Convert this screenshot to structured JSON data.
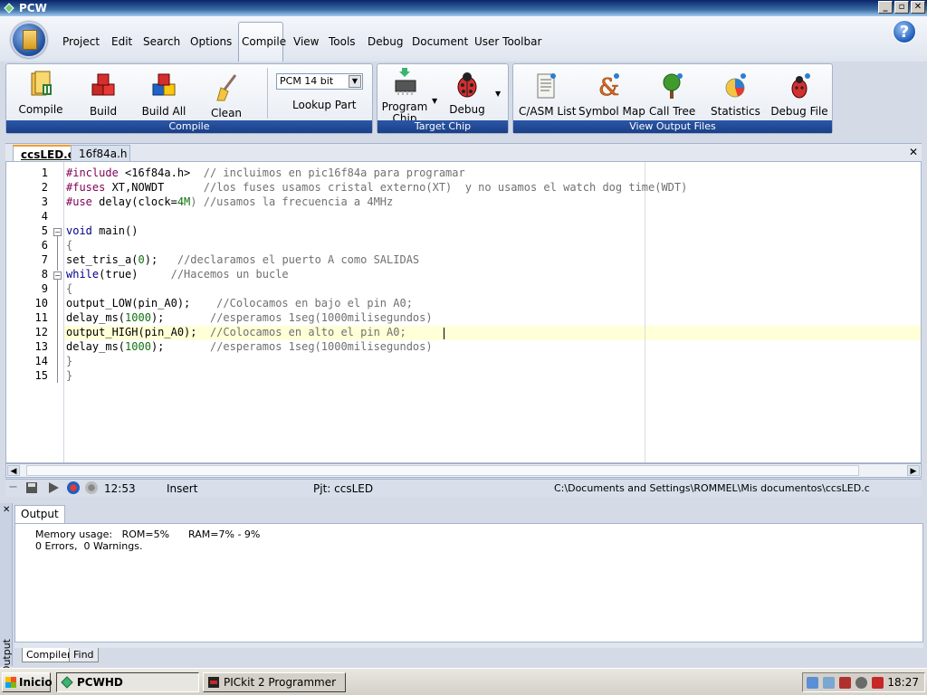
{
  "window": {
    "title": "PCW",
    "buttons": [
      "_",
      "▫",
      "✕"
    ]
  },
  "menu": {
    "items": [
      "Project",
      "Edit",
      "Search",
      "Options",
      "Compile",
      "View",
      "Tools",
      "Debug",
      "Document",
      "User Toolbar"
    ],
    "active": "Compile"
  },
  "ribbon": {
    "compile_group": {
      "title": "Compile",
      "buttons": {
        "compile": "Compile",
        "build": "Build",
        "build_all": "Build All",
        "clean": "Clean"
      },
      "pcm_select": "PCM 14 bit",
      "lookup": "Lookup Part"
    },
    "target_group": {
      "title": "Target Chip",
      "buttons": {
        "program_line1": "Program",
        "program_line2": "Chip",
        "debug": "Debug"
      }
    },
    "view_group": {
      "title": "View Output Files",
      "buttons": {
        "casm": "C/ASM List",
        "symbol": "Symbol Map",
        "calltree": "Call Tree",
        "stats": "Statistics",
        "debugfile": "Debug File"
      }
    }
  },
  "doc_tabs": [
    "ccsLED.c",
    "16f84a.h"
  ],
  "editor": {
    "line_numbers": [
      "1",
      "2",
      "3",
      "4",
      "5",
      "6",
      "7",
      "8",
      "9",
      "10",
      "11",
      "12",
      "13",
      "14",
      "15"
    ],
    "code": {
      "l1a": "#include",
      "l1b": " <16f84a.h>",
      "l1c": "  // incluimos en pic16f84a para programar",
      "l2a": "#fuses",
      "l2b": " XT,NOWDT",
      "l2c": "      //los fuses usamos cristal externo(XT)  y no usamos el watch dog time(WDT)",
      "l3a": "#use",
      "l3b": " delay(clock=",
      "l3n": "4M",
      "l3c": ") //usamos la frecuencia a 4MHz",
      "l5a": "void",
      "l5b": " main()",
      "l6": "{",
      "l7a": "set_tris_a(",
      "l7n": "0",
      "l7b": ");",
      "l7c": "   //declaramos el puerto A como SALIDAS",
      "l8a": "while",
      "l8b": "(true)",
      "l8c": "     //Hacemos un bucle",
      "l9": "{",
      "l10a": "output_LOW(pin_A0);",
      "l10c": "    //Colocamos en bajo el pin A0;",
      "l11a": "delay_ms(",
      "l11n": "1000",
      "l11b": ");",
      "l11c": "       //esperamos 1seg(1000milisegundos)",
      "l12a": "output_HIGH(pin_A0);",
      "l12c": "  //Colocamos en alto el pin A0;",
      "l13a": "delay_ms(",
      "l13n": "1000",
      "l13b": ");",
      "l13c": "       //esperamos 1seg(1000milisegundos)",
      "l14": "}",
      "l15": "}"
    }
  },
  "status": {
    "time": "12:53",
    "mode": "Insert",
    "project": "Pjt: ccsLED",
    "path": "C:\\Documents and Settings\\ROMMEL\\Mis documentos\\ccsLED.c"
  },
  "output": {
    "tab": "Output",
    "side_label": "Output",
    "lines": [
      "Memory usage:   ROM=5%      RAM=7% - 9%",
      "0 Errors,  0 Warnings."
    ],
    "bottom_tabs": [
      "Compiler",
      "Find"
    ]
  },
  "taskbar": {
    "start": "Inicio",
    "tasks": [
      "PCWHD",
      "PICkit 2 Programmer"
    ],
    "clock": "18:27"
  },
  "colors": {
    "accent": "#1a3f86",
    "preproc": "#7f0055",
    "keyword": "#00008b",
    "comment": "#707070",
    "number": "#107010"
  }
}
